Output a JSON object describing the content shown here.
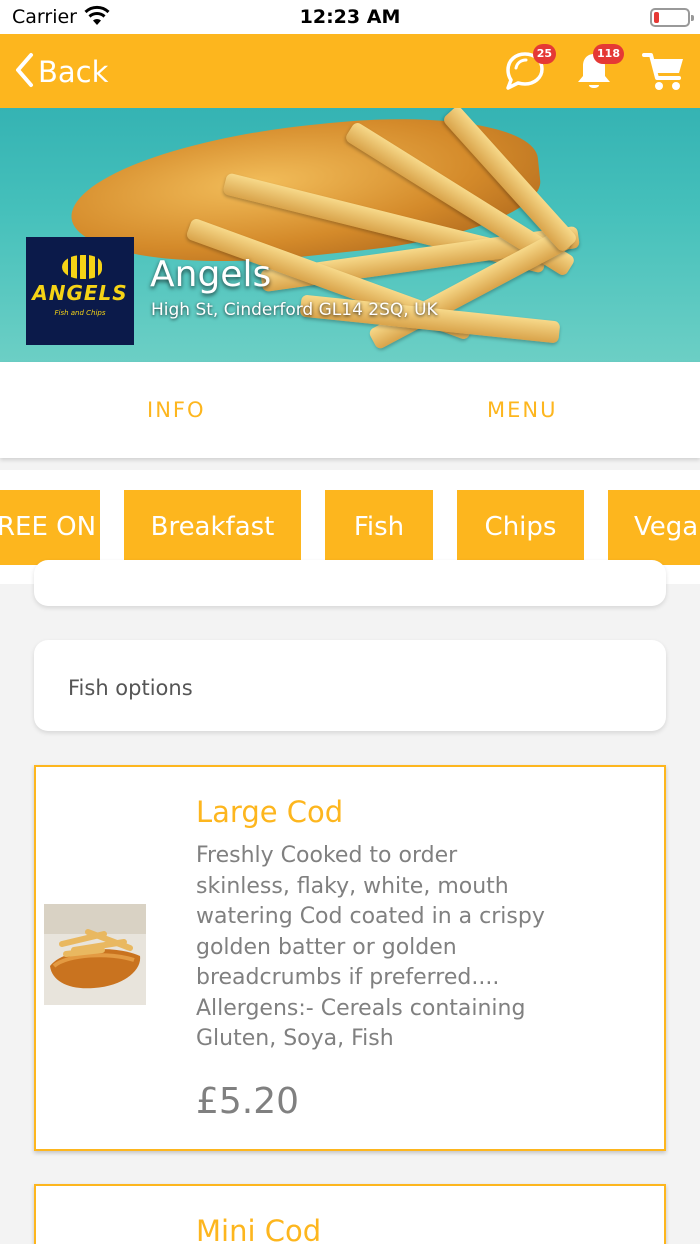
{
  "status_bar": {
    "carrier": "Carrier",
    "time": "12:23 AM"
  },
  "nav": {
    "back_label": "Back",
    "chat_badge": "25",
    "notification_badge": "118",
    "icons": [
      "chevron-left-icon",
      "chat-icon",
      "bell-icon",
      "cart-icon"
    ]
  },
  "restaurant": {
    "logo_text": "ANGELS",
    "logo_subtitle": "Fish and Chips",
    "name": "Angels",
    "address": "High St, Cinderford GL14 2SQ, UK"
  },
  "tabs": [
    {
      "label": "INFO"
    },
    {
      "label": "MENU"
    }
  ],
  "categories": [
    {
      "label": "FREE ON"
    },
    {
      "label": "Breakfast"
    },
    {
      "label": "Fish",
      "selected": true
    },
    {
      "label": "Chips"
    },
    {
      "label": "Vega"
    }
  ],
  "section": {
    "options_label": "Fish options"
  },
  "items": [
    {
      "title": "Large Cod",
      "description": [
        "Freshly Cooked to order",
        "skinless, flaky, white, mouth",
        "watering Cod coated in a crispy",
        "golden batter or golden",
        "breadcrumbs if preferred....",
        "Allergens:- Cereals containing",
        "Gluten, Soya, Fish"
      ],
      "price": "£5.20"
    },
    {
      "title": "Mini Cod"
    }
  ],
  "colors": {
    "brand": "#fdb61e",
    "badge": "#e53935",
    "text_muted": "#808080",
    "logo_bg": "#0b1a4a"
  }
}
